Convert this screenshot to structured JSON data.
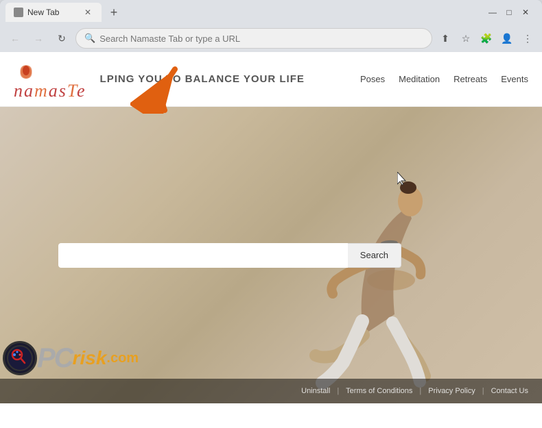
{
  "browser": {
    "title_bar": {
      "tab_label": "New Tab",
      "new_tab_icon": "+",
      "minimize_icon": "—",
      "maximize_icon": "□",
      "close_icon": "✕",
      "resize_icon": "⌄",
      "window_controls": [
        "↓",
        "—",
        "□",
        "✕"
      ]
    },
    "toolbar": {
      "back_icon": "←",
      "forward_icon": "→",
      "refresh_icon": "↻",
      "address_placeholder": "Search Namaste Tab or type a URL",
      "share_icon": "⬆",
      "bookmark_icon": "☆",
      "extension_icon": "🧩",
      "profile_icon": "👤",
      "menu_icon": "⋮"
    }
  },
  "site": {
    "logo_text": "namaste",
    "tagline": "LPING YOU TO BALANCE YOUR LIFE",
    "nav_items": [
      "Poses",
      "Meditation",
      "Retreats",
      "Events"
    ],
    "search_placeholder": "",
    "search_button_label": "Search",
    "footer_links": [
      "Uninstall",
      "Terms of Conditions",
      "Privacy Policy",
      "Contact Us"
    ]
  },
  "watermark": {
    "pc_text": "PC",
    "risk_text": "risk",
    "dot_com": ".com"
  }
}
